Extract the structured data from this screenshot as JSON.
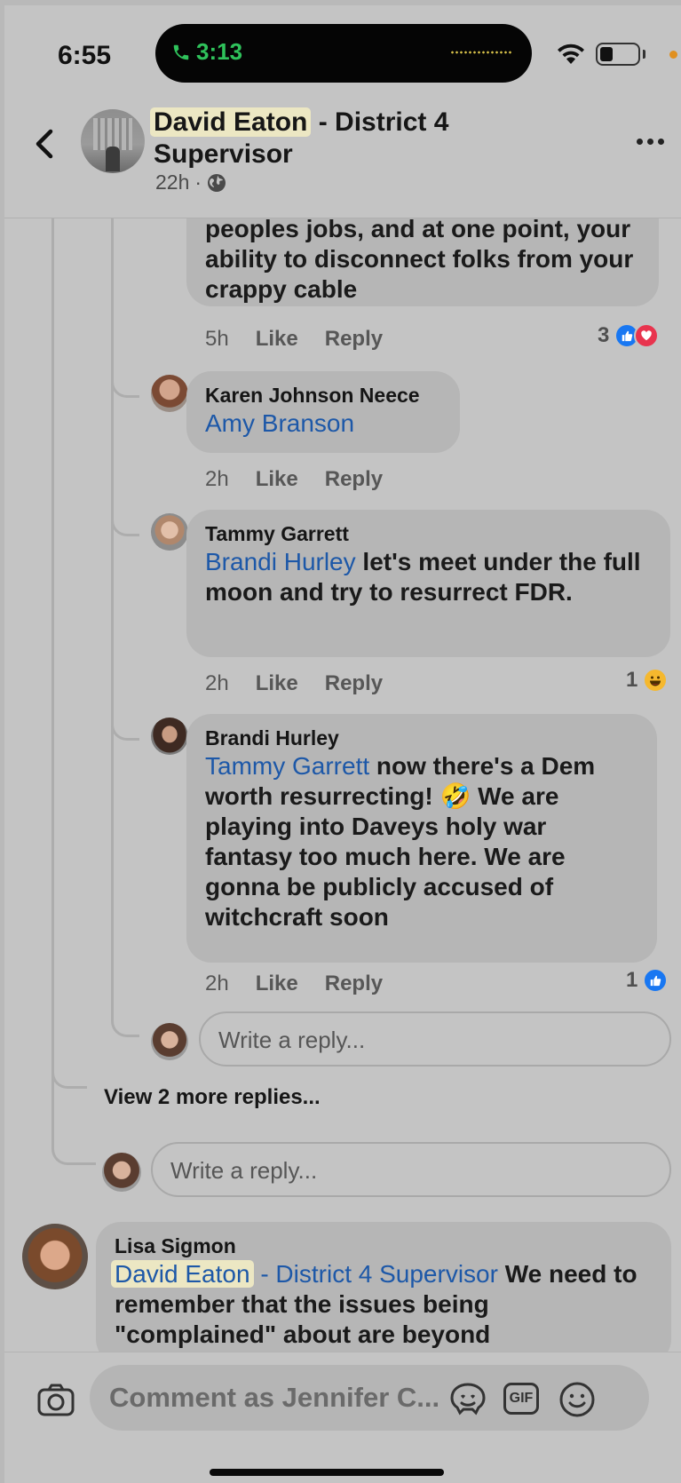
{
  "status": {
    "time": "6:55",
    "call_time": "3:13"
  },
  "header": {
    "name_highlight": "David Eaton",
    "name_rest": " - District 4 Supervisor",
    "age": "22h",
    "dot": "·",
    "more": "···"
  },
  "comments": [
    {
      "partial_text": "peoples jobs, and at one point, your ability to disconnect folks from your crappy cable",
      "time": "5h",
      "like": "Like",
      "reply": "Reply",
      "reaction_count": "3",
      "reactions": [
        "like",
        "love"
      ]
    },
    {
      "author": "Karen Johnson Neece",
      "mention": "Amy Branson",
      "text": "",
      "time": "2h",
      "like": "Like",
      "reply": "Reply"
    },
    {
      "author": "Tammy Garrett",
      "mention": "Brandi Hurley",
      "text": " let's meet under the full moon and try to resurrect FDR.",
      "time": "2h",
      "like": "Like",
      "reply": "Reply",
      "reaction_count": "1",
      "reactions": [
        "haha"
      ]
    },
    {
      "author": "Brandi Hurley",
      "mention": "Tammy Garrett",
      "text": " now there's a Dem worth resurrecting! 🤣 We are playing into Daveys holy war fantasy too much here. We are gonna be publicly accused of witchcraft soon",
      "time": "2h",
      "like": "Like",
      "reply": "Reply",
      "reaction_count": "1",
      "reactions": [
        "like"
      ]
    },
    {
      "author": "Lisa Sigmon",
      "mention_highlight": "David Eaton",
      "mention_rest": " - District 4 Supervisor",
      "text": " We need to remember that the issues being \"complained\" about are beyond"
    }
  ],
  "reply_placeholder": "Write a reply...",
  "view_more": "View 2 more replies...",
  "composer": {
    "placeholder": "Comment as Jennifer C...",
    "gif": "GIF"
  },
  "colors": {
    "mention": "#1d58a8",
    "like_blue": "#1877f2",
    "love_red": "#e8344e",
    "call_green": "#2fc25b"
  }
}
